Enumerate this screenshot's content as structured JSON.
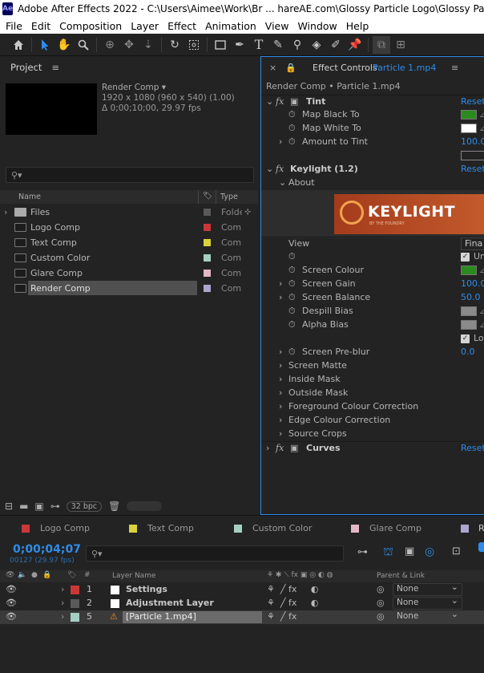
{
  "title_bar": {
    "app_icon": "Ae",
    "text": "Adobe After Effects 2022 - C:\\Users\\Aimee\\Work\\Br ... hareAE.com\\Glossy Particle Logo\\Glossy Particle Logo C"
  },
  "menu": [
    "File",
    "Edit",
    "Composition",
    "Layer",
    "Effect",
    "Animation",
    "View",
    "Window",
    "Help"
  ],
  "toolbar_icons": [
    "home-icon",
    "selection-tool-icon",
    "hand-tool-icon",
    "zoom-tool-icon",
    "orbit-camera-icon",
    "pan-camera-icon",
    "dolly-camera-icon",
    "rotation-tool-icon",
    "pan-behind-icon",
    "rectangle-tool-icon",
    "pen-tool-icon",
    "type-tool-icon",
    "brush-tool-icon",
    "clone-stamp-icon",
    "eraser-icon",
    "roto-brush-icon",
    "puppet-pin-icon"
  ],
  "project": {
    "tab_label": "Project",
    "menu_icon": "≡",
    "comp_name": "Render Comp",
    "comp_size": "1920 x 1080  (960 x 540) (1.00)",
    "comp_duration": "Δ 0;00;10;00, 29.97 fps",
    "search_placeholder": "",
    "columns": {
      "name": "Name",
      "type": "Type"
    },
    "items": [
      {
        "name": "Files",
        "type": "Folder",
        "color": "#5a5a5a",
        "kind": "folder"
      },
      {
        "name": "Logo Comp",
        "type": "Comp",
        "color": "#c93838",
        "kind": "comp"
      },
      {
        "name": "Text Comp",
        "type": "Comp",
        "color": "#d9d23a",
        "kind": "comp"
      },
      {
        "name": "Custom Color",
        "type": "Comp",
        "color": "#a6cfc4",
        "kind": "comp"
      },
      {
        "name": "Glare Comp",
        "type": "Comp",
        "color": "#e3b7c3",
        "kind": "comp"
      },
      {
        "name": "Render Comp",
        "type": "Comp",
        "color": "#aba6cf",
        "kind": "comp",
        "selected": true
      }
    ],
    "bpc": "32 bpc"
  },
  "effects": {
    "tab_label": "Effect Controls",
    "tab_layer": "Particle 1.mp4",
    "breadcrumb": "Render Comp • Particle 1.mp4",
    "tint": {
      "name": "Tint",
      "reset": "Reset",
      "map_black_label": "Map Black To",
      "map_black_color": "#2b8a1e",
      "map_white_label": "Map White To",
      "map_white_color": "#ffffff",
      "amount_label": "Amount to Tint",
      "amount_value": "100.0"
    },
    "keylight": {
      "name": "Keylight (1.2)",
      "reset": "Reset",
      "about": "About",
      "banner_text": "KEYLIGHT",
      "banner_sub": "BY THE FOUNDRY",
      "view_label": "View",
      "view_value": "Fina",
      "unpremult_label": "Un",
      "screen_colour_label": "Screen Colour",
      "screen_colour": "#2b8a1e",
      "screen_gain_label": "Screen Gain",
      "screen_gain": "100.0",
      "screen_balance_label": "Screen Balance",
      "screen_balance": "50.0",
      "despill_label": "Despill Bias",
      "alpha_label": "Alpha Bias",
      "lock_label": "Lo",
      "preblur_label": "Screen Pre-blur",
      "preblur": "0.0",
      "groups": [
        "Screen Matte",
        "Inside Mask",
        "Outside Mask",
        "Foreground Colour Correction",
        "Edge Colour Correction",
        "Source Crops"
      ]
    },
    "curves": {
      "name": "Curves",
      "reset": "Reset"
    }
  },
  "timeline": {
    "tabs": [
      {
        "label": "Logo Comp",
        "color": "#c93838"
      },
      {
        "label": "Text Comp",
        "color": "#d9d23a"
      },
      {
        "label": "Custom Color",
        "color": "#a6cfc4"
      },
      {
        "label": "Glare Comp",
        "color": "#e3b7c3"
      },
      {
        "label": "R",
        "color": "#aba6cf"
      }
    ],
    "timecode": "0;00;04;07",
    "frame_info": "00127 (29.97 fps)",
    "headers": {
      "layer_name": "Layer Name",
      "parent": "Parent & Link"
    },
    "layers": [
      {
        "num": "1",
        "name": "Settings",
        "color": "#c93838",
        "swatch": "#ffffff",
        "parent": "None"
      },
      {
        "num": "2",
        "name": "Adjustment Layer",
        "color": "#5a5a5a",
        "swatch": "#ffffff",
        "parent": "None"
      },
      {
        "num": "5",
        "name": "[Particle 1.mp4]",
        "color": "#a6cfc4",
        "swatch": "cone",
        "parent": "None",
        "selected": true
      }
    ]
  }
}
